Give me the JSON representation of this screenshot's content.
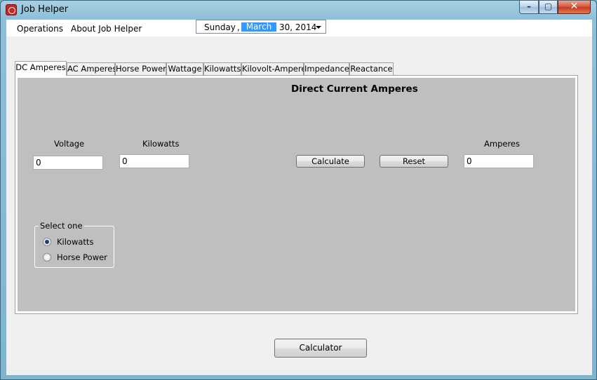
{
  "window": {
    "title": "Job Helper"
  },
  "menu": {
    "operations": "Operations",
    "about": "About Job Helper"
  },
  "date_picker": {
    "day": "Sunday",
    "separator": ",",
    "month": "March",
    "rest": "30, 2014"
  },
  "tabs": [
    "DC Amperes",
    "AC Amperes",
    "Horse Power",
    "Wattage",
    "Kilowatts",
    "Kilovolt-Amperes",
    "Impedance",
    "Reactance"
  ],
  "panel": {
    "title": "Direct Current Amperes",
    "voltage_label": "Voltage",
    "voltage_value": "0",
    "kilowatts_label": "Kilowatts",
    "kilowatts_value": "0",
    "amperes_label": "Amperes",
    "amperes_value": "0",
    "calculate_label": "Calculate",
    "reset_label": "Reset",
    "group_label": "Select one",
    "option_kilowatts": "Kilowatts",
    "option_horse_power": "Horse Power"
  },
  "footer": {
    "calculator_label": "Calculator"
  }
}
